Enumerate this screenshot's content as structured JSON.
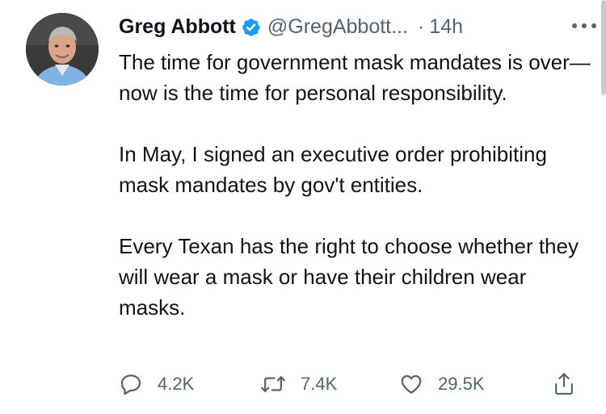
{
  "tweet": {
    "author": {
      "name": "Greg Abbott",
      "handle": "@GregAbbott...",
      "separator": "·",
      "time": "14h",
      "verified": true
    },
    "paragraphs": [
      "The time for government mask mandates is over—now is the time for personal responsibility.",
      "In May, I signed an executive order prohibiting mask mandates by gov't entities.",
      "Every Texan has the right to choose whether they will wear a mask or have their children wear masks."
    ],
    "actions": {
      "reply_count": "4.2K",
      "retweet_count": "7.4K",
      "like_count": "29.5K"
    }
  },
  "colors": {
    "verified_blue": "#1d9bf0",
    "text_primary": "#0f1419",
    "text_secondary": "#536471"
  },
  "icons": [
    "avatar-photo",
    "verified-badge-icon",
    "more-options-icon",
    "reply-icon",
    "retweet-icon",
    "like-icon",
    "share-icon"
  ]
}
